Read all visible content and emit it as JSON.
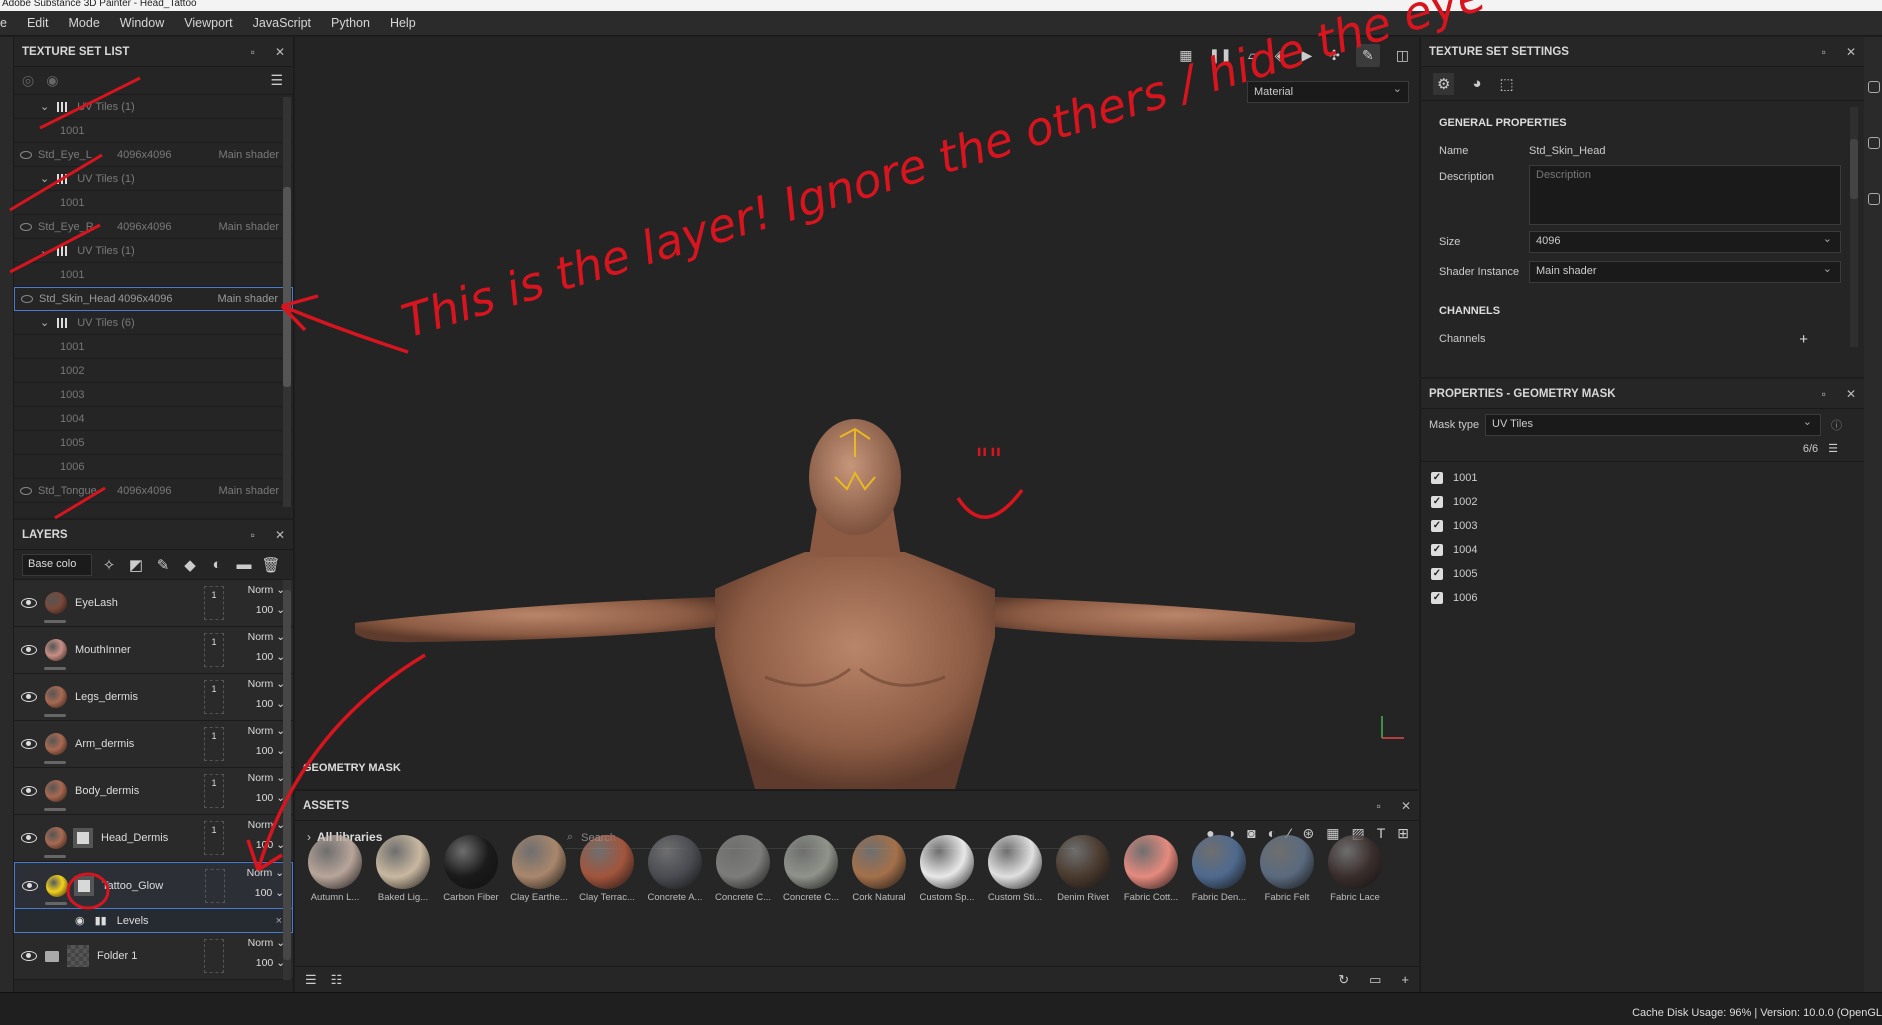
{
  "window_title": "Adobe Substance 3D Painter - Head_Tattoo",
  "menu": [
    "e",
    "Edit",
    "Mode",
    "Window",
    "Viewport",
    "JavaScript",
    "Python",
    "Help"
  ],
  "texture_set_list": {
    "title": "TEXTURE SET LIST",
    "rows": [
      {
        "kind": "uvhdr",
        "label": "UV Tiles (1)"
      },
      {
        "kind": "tile",
        "label": "1001"
      },
      {
        "kind": "set",
        "name": "Std_Eye_L",
        "res": "4096x4096",
        "shader": "Main shader"
      },
      {
        "kind": "uvhdr",
        "label": "UV Tiles (1)"
      },
      {
        "kind": "tile",
        "label": "1001"
      },
      {
        "kind": "set",
        "name": "Std_Eye_R",
        "res": "4096x4096",
        "shader": "Main shader"
      },
      {
        "kind": "uvhdr",
        "label": "UV Tiles (1)"
      },
      {
        "kind": "tile",
        "label": "1001"
      },
      {
        "kind": "set",
        "name": "Std_Skin_Head",
        "res": "4096x4096",
        "shader": "Main shader",
        "selected": true
      },
      {
        "kind": "uvhdr",
        "label": "UV Tiles (6)"
      },
      {
        "kind": "tile",
        "label": "1001"
      },
      {
        "kind": "tile",
        "label": "1002"
      },
      {
        "kind": "tile",
        "label": "1003"
      },
      {
        "kind": "tile",
        "label": "1004"
      },
      {
        "kind": "tile",
        "label": "1005"
      },
      {
        "kind": "tile",
        "label": "1006"
      },
      {
        "kind": "set",
        "name": "Std_Tongue",
        "res": "4096x4096",
        "shader": "Main shader"
      }
    ]
  },
  "layers": {
    "title": "LAYERS",
    "channel": "Base colo",
    "items": [
      {
        "name": "EyeLash",
        "blend": "Norm",
        "opacity": "100",
        "count": "1",
        "color": "#7a4a3a"
      },
      {
        "name": "MouthInner",
        "blend": "Norm",
        "opacity": "100",
        "count": "1",
        "color": "#c88f86"
      },
      {
        "name": "Legs_dermis",
        "blend": "Norm",
        "opacity": "100",
        "count": "1",
        "color": "#a86a52"
      },
      {
        "name": "Arm_dermis",
        "blend": "Norm",
        "opacity": "100",
        "count": "1",
        "color": "#a86a52"
      },
      {
        "name": "Body_dermis",
        "blend": "Norm",
        "opacity": "100",
        "count": "1",
        "color": "#a86a52"
      },
      {
        "name": "Head_Dermis",
        "blend": "Norm",
        "opacity": "100",
        "count": "1",
        "color": "#a86a52",
        "mask": true
      },
      {
        "name": "Tattoo_Glow",
        "blend": "Norm",
        "opacity": "100",
        "count": "",
        "color": "#f2d21c",
        "mask": true,
        "selected": true
      }
    ],
    "sublayer": "Levels",
    "folder": {
      "name": "Folder 1",
      "blend": "Norm",
      "opacity": "100"
    }
  },
  "viewport": {
    "mode_dropdown": "Material",
    "geometry_mask_label": "GEOMETRY MASK"
  },
  "assets": {
    "title": "ASSETS",
    "library": "All libraries",
    "search_placeholder": "Search",
    "items": [
      {
        "name": "Autumn L...",
        "color": "#b8a59a"
      },
      {
        "name": "Baked Lig...",
        "color": "#c9b8a0"
      },
      {
        "name": "Carbon Fiber",
        "color": "#1a1a1a"
      },
      {
        "name": "Clay Earthe...",
        "color": "#a9876c"
      },
      {
        "name": "Clay Terrac...",
        "color": "#a2553c"
      },
      {
        "name": "Concrete A...",
        "color": "#4a4c52"
      },
      {
        "name": "Concrete C...",
        "color": "#7c7c7a"
      },
      {
        "name": "Concrete C...",
        "color": "#8f938a"
      },
      {
        "name": "Cork Natural",
        "color": "#a4704a"
      },
      {
        "name": "Custom Sp...",
        "color": "#e8e8e8"
      },
      {
        "name": "Custom Sti...",
        "color": "#e0e0e0"
      },
      {
        "name": "Denim Rivet",
        "color": "#4a3a2e"
      },
      {
        "name": "Fabric Cott...",
        "color": "#e58a7e"
      },
      {
        "name": "Fabric Den...",
        "color": "#4f6a8e"
      },
      {
        "name": "Fabric Felt",
        "color": "#5a6a7e"
      },
      {
        "name": "Fabric Lace",
        "color": "#3a2e2c"
      }
    ]
  },
  "texture_set_settings": {
    "title": "TEXTURE SET SETTINGS",
    "general_title": "GENERAL PROPERTIES",
    "name_label": "Name",
    "name_value": "Std_Skin_Head",
    "description_label": "Description",
    "description_placeholder": "Description",
    "size_label": "Size",
    "size_value": "4096",
    "shader_label": "Shader Instance",
    "shader_value": "Main shader",
    "channels_title": "CHANNELS",
    "channels_label": "Channels"
  },
  "geometry_mask_panel": {
    "title": "PROPERTIES - GEOMETRY MASK",
    "mask_type_label": "Mask type",
    "mask_type_value": "UV Tiles",
    "tile_count": "6/6",
    "tiles": [
      "1001",
      "1002",
      "1003",
      "1004",
      "1005",
      "1006"
    ]
  },
  "status_bar": {
    "text": "Cache Disk Usage:   96% | Version: 10.0.0 (OpenGL"
  },
  "annotations": {
    "main_note": "This is the layer! Ignore the others / hide the eye",
    "smiley": "\"\""
  },
  "colors": {
    "annotation_red": "#d8151f",
    "selection_blue": "#4a7bd3",
    "panel_bg": "#252525"
  }
}
